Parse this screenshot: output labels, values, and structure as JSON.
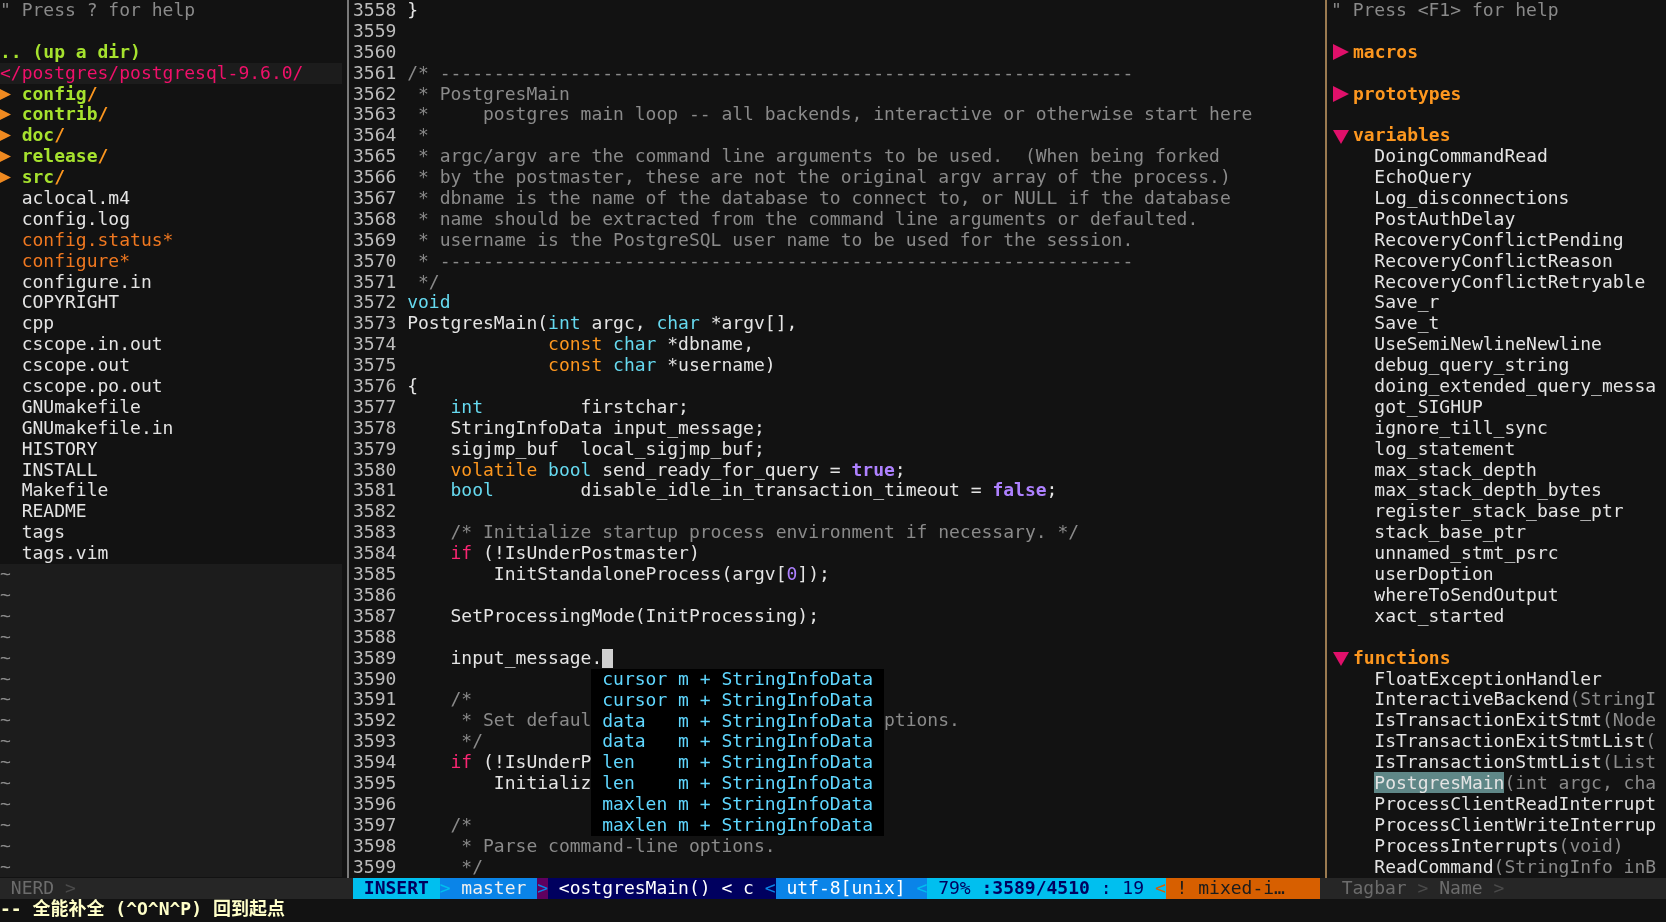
{
  "file_tree": {
    "help": "\" Press ? for help",
    "up_dir": ".. (up a dir)",
    "root": "</postgres/postgresql-9.6.0/",
    "items": [
      {
        "kind": "dir",
        "name": "config",
        "slash": "/",
        "expanded": false
      },
      {
        "kind": "dir",
        "name": "contrib",
        "slash": "/",
        "expanded": false
      },
      {
        "kind": "dir",
        "name": "doc",
        "slash": "/",
        "expanded": false
      },
      {
        "kind": "dir",
        "name": "release",
        "slash": "/",
        "expanded": false
      },
      {
        "kind": "dir",
        "name": "src",
        "slash": "/",
        "expanded": false
      },
      {
        "kind": "file",
        "name": "aclocal.m4"
      },
      {
        "kind": "file",
        "name": "config.log"
      },
      {
        "kind": "exec",
        "name": "config.status*"
      },
      {
        "kind": "exec",
        "name": "configure*"
      },
      {
        "kind": "file",
        "name": "configure.in"
      },
      {
        "kind": "file",
        "name": "COPYRIGHT"
      },
      {
        "kind": "file",
        "name": "cpp"
      },
      {
        "kind": "file",
        "name": "cscope.in.out"
      },
      {
        "kind": "file",
        "name": "cscope.out"
      },
      {
        "kind": "file",
        "name": "cscope.po.out"
      },
      {
        "kind": "file",
        "name": "GNUmakefile"
      },
      {
        "kind": "file",
        "name": "GNUmakefile.in"
      },
      {
        "kind": "file",
        "name": "HISTORY"
      },
      {
        "kind": "file",
        "name": "INSTALL"
      },
      {
        "kind": "file",
        "name": "Makefile"
      },
      {
        "kind": "file",
        "name": "README"
      },
      {
        "kind": "file",
        "name": "tags"
      },
      {
        "kind": "file",
        "name": "tags.vim"
      }
    ],
    "fillers": [
      "~",
      "~",
      "~",
      "~",
      "~",
      "~",
      "~",
      "~",
      "~",
      "~",
      "~",
      "~",
      "~",
      "~",
      "~"
    ]
  },
  "editor": {
    "lines": [
      {
        "number": "3558",
        "cursor": false,
        "segments": [
          {
            "text": "}",
            "kind": "plain"
          }
        ]
      },
      {
        "number": "3559",
        "cursor": false
      },
      {
        "number": "3560",
        "cursor": false
      },
      {
        "number": "3561",
        "cursor": false,
        "segments": [
          {
            "text": "/* ----------------------------------------------------------------",
            "kind": "comment"
          }
        ]
      },
      {
        "number": "3562",
        "cursor": false,
        "segments": [
          {
            "text": " * PostgresMain",
            "kind": "comment"
          }
        ]
      },
      {
        "number": "3563",
        "cursor": false,
        "segments": [
          {
            "text": " *     postgres main loop -- all backends, interactive or otherwise start here",
            "kind": "comment"
          }
        ]
      },
      {
        "number": "3564",
        "cursor": false,
        "segments": [
          {
            "text": " *",
            "kind": "comment"
          }
        ]
      },
      {
        "number": "3565",
        "cursor": false,
        "segments": [
          {
            "text": " * argc/argv are the command line arguments to be used.  (When being forked",
            "kind": "comment"
          }
        ]
      },
      {
        "number": "3566",
        "cursor": false,
        "segments": [
          {
            "text": " * by the postmaster, these are not the original argv array of the process.)",
            "kind": "comment"
          }
        ]
      },
      {
        "number": "3567",
        "cursor": false,
        "segments": [
          {
            "text": " * dbname is the name of the database to connect to, or NULL if the database",
            "kind": "comment"
          }
        ]
      },
      {
        "number": "3568",
        "cursor": false,
        "segments": [
          {
            "text": " * name should be extracted from the command line arguments or defaulted.",
            "kind": "comment"
          }
        ]
      },
      {
        "number": "3569",
        "cursor": false,
        "segments": [
          {
            "text": " * username is the PostgreSQL user name to be used for the session.",
            "kind": "comment"
          }
        ]
      },
      {
        "number": "3570",
        "cursor": false,
        "segments": [
          {
            "text": " * ----------------------------------------------------------------",
            "kind": "comment"
          }
        ]
      },
      {
        "number": "3571",
        "cursor": false,
        "segments": [
          {
            "text": " */",
            "kind": "comment"
          }
        ]
      },
      {
        "number": "3572",
        "cursor": false,
        "segments": [
          {
            "text": "void",
            "kind": "type"
          }
        ]
      },
      {
        "number": "3573",
        "cursor": false,
        "segments": [
          {
            "text": "PostgresMain(",
            "kind": "plain"
          },
          {
            "text": "int",
            "kind": "type"
          },
          {
            "text": " argc, ",
            "kind": "plain"
          },
          {
            "text": "char",
            "kind": "type"
          },
          {
            "text": " *argv[],",
            "kind": "plain"
          }
        ]
      },
      {
        "number": "3574",
        "cursor": false,
        "segments": [
          {
            "text": "             const",
            "kind": "storage"
          },
          {
            "text": " char",
            "kind": "type"
          },
          {
            "text": " *dbname,",
            "kind": "plain"
          }
        ]
      },
      {
        "number": "3575",
        "cursor": false,
        "segments": [
          {
            "text": "             const",
            "kind": "storage"
          },
          {
            "text": " char",
            "kind": "type"
          },
          {
            "text": " *username)",
            "kind": "plain"
          }
        ]
      },
      {
        "number": "3576",
        "cursor": false,
        "segments": [
          {
            "text": "{",
            "kind": "plain"
          }
        ]
      },
      {
        "number": "3577",
        "cursor": false,
        "segments": [
          {
            "text": "    int",
            "kind": "type"
          },
          {
            "text": "         firstchar;",
            "kind": "plain"
          }
        ]
      },
      {
        "number": "3578",
        "cursor": false,
        "segments": [
          {
            "text": "    StringInfoData input_message;",
            "kind": "plain"
          }
        ]
      },
      {
        "number": "3579",
        "cursor": false,
        "segments": [
          {
            "text": "    sigjmp_buf  local_sigjmp_buf;",
            "kind": "plain"
          }
        ]
      },
      {
        "number": "3580",
        "cursor": false,
        "segments": [
          {
            "text": "    volatile",
            "kind": "storage"
          },
          {
            "text": " bool",
            "kind": "type"
          },
          {
            "text": " send_ready_for_query = ",
            "kind": "plain"
          },
          {
            "text": "true",
            "kind": "boolean"
          },
          {
            "text": ";",
            "kind": "plain"
          }
        ]
      },
      {
        "number": "3581",
        "cursor": false,
        "segments": [
          {
            "text": "    bool",
            "kind": "type"
          },
          {
            "text": "        disable_idle_in_transaction_timeout = ",
            "kind": "plain"
          },
          {
            "text": "false",
            "kind": "boolean"
          },
          {
            "text": ";",
            "kind": "plain"
          }
        ]
      },
      {
        "number": "3582",
        "cursor": false
      },
      {
        "number": "3583",
        "cursor": false,
        "segments": [
          {
            "text": "    /* Initialize startup process environment if necessary. */",
            "kind": "comment"
          }
        ]
      },
      {
        "number": "3584",
        "cursor": false,
        "segments": [
          {
            "text": "    if",
            "kind": "keyword"
          },
          {
            "text": " (!IsUnderPostmaster)",
            "kind": "plain"
          }
        ]
      },
      {
        "number": "3585",
        "cursor": false,
        "segments": [
          {
            "text": "        InitStandaloneProcess(argv[",
            "kind": "plain"
          },
          {
            "text": "0",
            "kind": "number"
          },
          {
            "text": "]);",
            "kind": "plain"
          }
        ]
      },
      {
        "number": "3586",
        "cursor": false
      },
      {
        "number": "3587",
        "cursor": false,
        "segments": [
          {
            "text": "    SetProcessingMode(InitProcessing);",
            "kind": "plain"
          }
        ]
      },
      {
        "number": "3588",
        "cursor": false
      },
      {
        "number": "3589",
        "cursor": true,
        "segments": [
          {
            "text": "    input_message.",
            "kind": "plain"
          }
        ]
      },
      {
        "number": "3590",
        "cursor": false
      },
      {
        "number": "3591",
        "cursor": false,
        "segments": [
          {
            "text": "    /*",
            "kind": "comment"
          }
        ]
      },
      {
        "number": "3592",
        "cursor": false,
        "segments": [
          {
            "text": "     * Set defaul",
            "kind": "comment"
          },
          {
            "text": "ptions.",
            "kind": "comment",
            "after_popup": true
          }
        ]
      },
      {
        "number": "3593",
        "cursor": false,
        "segments": [
          {
            "text": "     */",
            "kind": "comment"
          }
        ]
      },
      {
        "number": "3594",
        "cursor": false,
        "segments": [
          {
            "text": "    if",
            "kind": "keyword"
          },
          {
            "text": " (!IsUnderP",
            "kind": "plain"
          }
        ]
      },
      {
        "number": "3595",
        "cursor": false,
        "segments": [
          {
            "text": "        Initializ",
            "kind": "plain"
          }
        ]
      },
      {
        "number": "3596",
        "cursor": false
      },
      {
        "number": "3597",
        "cursor": false,
        "segments": [
          {
            "text": "    /*",
            "kind": "comment"
          }
        ]
      },
      {
        "number": "3598",
        "cursor": false,
        "segments": [
          {
            "text": "     * Parse command-line options.",
            "kind": "comment"
          }
        ]
      },
      {
        "number": "3599",
        "cursor": false,
        "segments": [
          {
            "text": "     */",
            "kind": "comment"
          }
        ]
      }
    ],
    "completion": [
      {
        "word": "cursor",
        "kind": "m",
        "menu": "+ StringInfoData"
      },
      {
        "word": "cursor",
        "kind": "m",
        "menu": "+ StringInfoData"
      },
      {
        "word": "data",
        "kind": "m",
        "menu": "+ StringInfoData"
      },
      {
        "word": "data",
        "kind": "m",
        "menu": "+ StringInfoData"
      },
      {
        "word": "len",
        "kind": "m",
        "menu": "+ StringInfoData"
      },
      {
        "word": "len",
        "kind": "m",
        "menu": "+ StringInfoData"
      },
      {
        "word": "maxlen",
        "kind": "m",
        "menu": "+ StringInfoData"
      },
      {
        "word": "maxlen",
        "kind": "m",
        "menu": "+ StringInfoData"
      }
    ]
  },
  "tagbar": {
    "help": "\" Press <F1> for help",
    "groups": [
      {
        "label": "macros",
        "expanded": false
      },
      {
        "label": "prototypes",
        "expanded": false
      },
      {
        "label": "variables",
        "expanded": true,
        "children": [
          {
            "name": "DoingCommandRead",
            "selected": false
          },
          {
            "name": "EchoQuery",
            "selected": false
          },
          {
            "name": "Log_disconnections",
            "selected": false
          },
          {
            "name": "PostAuthDelay",
            "selected": false
          },
          {
            "name": "RecoveryConflictPending",
            "selected": false
          },
          {
            "name": "RecoveryConflictReason",
            "selected": false
          },
          {
            "name": "RecoveryConflictRetryable",
            "selected": false
          },
          {
            "name": "Save_r",
            "selected": false
          },
          {
            "name": "Save_t",
            "selected": false
          },
          {
            "name": "UseSemiNewlineNewline",
            "selected": false
          },
          {
            "name": "debug_query_string",
            "selected": false
          },
          {
            "name": "doing_extended_query_messa",
            "selected": false
          },
          {
            "name": "got_SIGHUP",
            "selected": false
          },
          {
            "name": "ignore_till_sync",
            "selected": false
          },
          {
            "name": "log_statement",
            "selected": false
          },
          {
            "name": "max_stack_depth",
            "selected": false
          },
          {
            "name": "max_stack_depth_bytes",
            "selected": false
          },
          {
            "name": "register_stack_base_ptr",
            "selected": false
          },
          {
            "name": "stack_base_ptr",
            "selected": false
          },
          {
            "name": "unnamed_stmt_psrc",
            "selected": false
          },
          {
            "name": "userDoption",
            "selected": false
          },
          {
            "name": "whereToSendOutput",
            "selected": false
          },
          {
            "name": "xact_started",
            "selected": false
          }
        ]
      },
      {
        "label": "functions",
        "expanded": true,
        "children": [
          {
            "name": "FloatExceptionHandler",
            "selected": false
          },
          {
            "name": "InteractiveBackend",
            "signature": "(StringI",
            "selected": false
          },
          {
            "name": "IsTransactionExitStmt",
            "signature": "(Node",
            "selected": false
          },
          {
            "name": "IsTransactionExitStmtList",
            "signature": "(",
            "selected": false
          },
          {
            "name": "IsTransactionStmtList",
            "signature": "(List",
            "selected": false
          },
          {
            "name": "PostgresMain",
            "signature": "(int argc, cha",
            "selected": true
          },
          {
            "name": "ProcessClientReadInterrupt",
            "selected": false
          },
          {
            "name": "ProcessClientWriteInterrup",
            "selected": false
          },
          {
            "name": "ProcessInterrupts",
            "signature": "(void)",
            "selected": false
          },
          {
            "name": "ReadCommand",
            "signature": "(StringInfo inB",
            "selected": false
          }
        ]
      }
    ]
  },
  "status_line": {
    "tree": [
      {
        "text": "NERD",
        "kind": "inactive"
      },
      {
        "text": ">",
        "kind": "isep"
      }
    ],
    "editor": [
      {
        "text": "INSERT",
        "kind": "mode"
      },
      {
        "text": ">",
        "kind": "rsep"
      },
      {
        "text": "master",
        "kind": "branch"
      },
      {
        "text": ">",
        "kind": "rsep"
      },
      {
        "text": "<ostgresMain() < c",
        "kind": "function"
      },
      {
        "text": "<",
        "kind": "lsep"
      },
      {
        "text": "utf-8[unix]",
        "kind": "encoding"
      },
      {
        "text": "<",
        "kind": "lsep"
      },
      {
        "text": "79% **:3589/4510** : 19",
        "kind": "position"
      },
      {
        "text": "<",
        "kind": "lsep"
      },
      {
        "text": "! mixed-i…",
        "kind": "warning"
      }
    ],
    "tagbar": [
      {
        "text": "Tagbar",
        "kind": "inactive"
      },
      {
        "text": ">",
        "kind": "isep"
      },
      {
        "text": "Name",
        "kind": "inactive"
      },
      {
        "text": ">",
        "kind": "isep"
      }
    ]
  },
  "command_line": "-- 全能补全 (^O^N^P) 回到起点"
}
